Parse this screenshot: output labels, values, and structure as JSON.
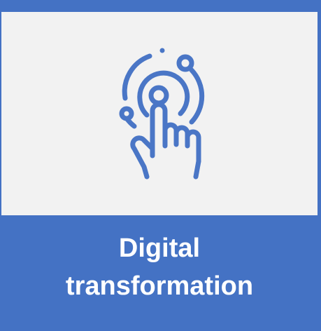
{
  "tile": {
    "label_line1": "Digital",
    "label_line2": "transformation",
    "icon": "touch-target-icon"
  },
  "colors": {
    "accent": "#4472c4",
    "panel": "#f2f2f2",
    "text": "#ffffff",
    "icon_stroke": "#4a76c6"
  }
}
